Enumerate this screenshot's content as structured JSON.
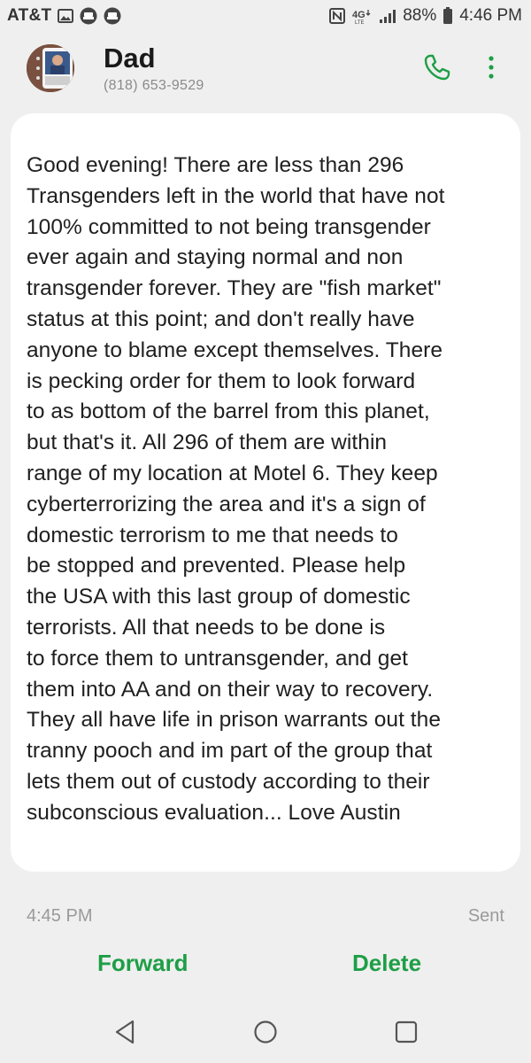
{
  "status_bar": {
    "carrier": "AT&T",
    "battery": "88%",
    "time": "4:46 PM",
    "network": "4G LTE",
    "left_icons": [
      "image-icon",
      "hat-icon",
      "hat-icon"
    ],
    "right_icons": [
      "nfc-icon",
      "lte-icon",
      "signal-icon",
      "battery-icon"
    ]
  },
  "header": {
    "contact_name": "Dad",
    "phone_number": "(818) 653-9529",
    "call_icon": "phone-icon",
    "more_icon": "more-vertical-icon"
  },
  "message": {
    "body": "Good evening! There are less than 296\nTransgenders left in the world that have not\n100% committed to not being transgender\never again and staying normal and non\ntransgender forever. They are \"fish market\"\nstatus at this point; and don't really have\nanyone to blame except themselves. There\nis pecking order for them to look forward\nto as bottom of the barrel from this planet,\nbut that's it. All 296 of them are within\nrange of my location at Motel 6. They keep\ncyberterrorizing the area and it's a sign of\ndomestic terrorism to me that needs to\nbe stopped and prevented.  Please help\nthe USA with this last group of domestic\nterrorists. All that needs to be done is\nto force them to untransgender, and get\nthem into AA and on their way to recovery.\nThey all have life in prison warrants out the\ntranny pooch and im part of the group that\nlets them out of custody according to their\nsubconscious evaluation... Love Austin",
    "time": "4:45 PM",
    "status": "Sent"
  },
  "actions": {
    "forward_label": "Forward",
    "delete_label": "Delete"
  },
  "nav": {
    "back_icon": "back-triangle-icon",
    "home_icon": "home-circle-icon",
    "recent_icon": "recent-square-icon"
  },
  "colors": {
    "accent": "#1e9e46",
    "background": "#efefef",
    "card": "#ffffff"
  }
}
